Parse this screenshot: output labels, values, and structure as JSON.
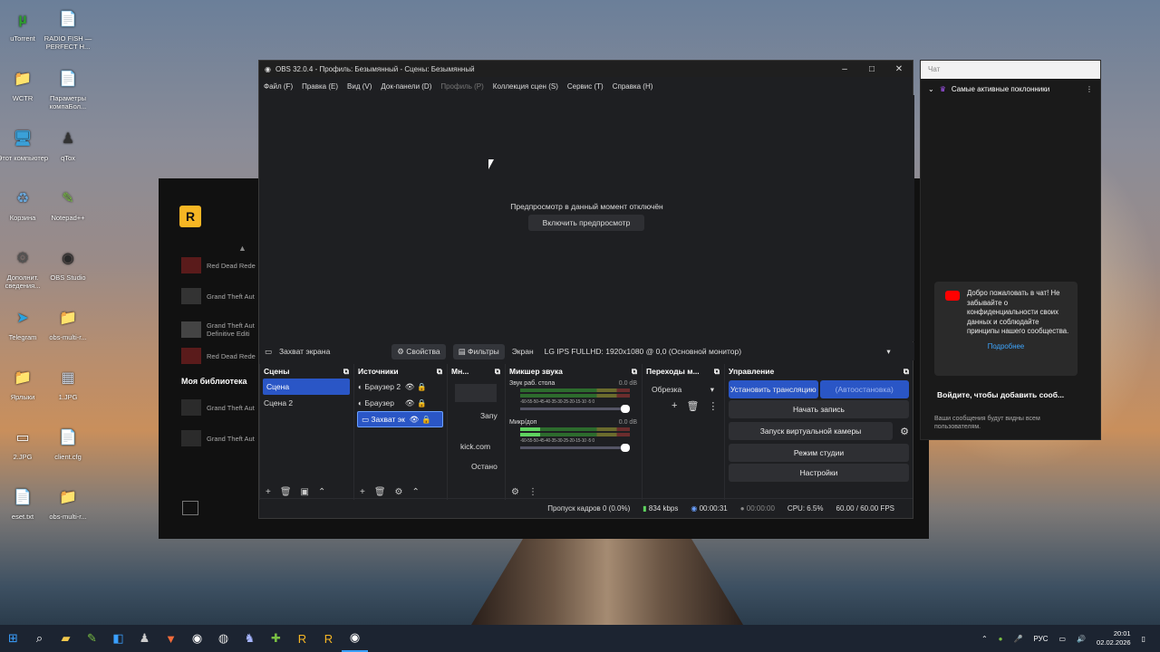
{
  "desktop": {
    "icons": [
      {
        "label": "uTorrent",
        "glyph": "µ",
        "color": "#2ea12e"
      },
      {
        "label": "RADIO FISH — PERFECT H...",
        "glyph": "📄",
        "color": "#eee"
      },
      {
        "label": "WCTR",
        "glyph": "📁",
        "color": "#e8c34a"
      },
      {
        "label": "Параметры компаБол...",
        "glyph": "📄",
        "color": "#eee"
      },
      {
        "label": "Этот компьютер",
        "glyph": "🖥",
        "color": "#3aa0d8"
      },
      {
        "label": "qTox",
        "glyph": "♟",
        "color": "#333"
      },
      {
        "label": "Корзина",
        "glyph": "♻",
        "color": "#6aa6d8"
      },
      {
        "label": "Notepad++",
        "glyph": "✎",
        "color": "#7ac043"
      },
      {
        "label": "Дополнит. сведения...",
        "glyph": "⚙",
        "color": "#555"
      },
      {
        "label": "OBS Studio",
        "glyph": "◉",
        "color": "#2a2a2a"
      },
      {
        "label": "Telegram",
        "glyph": "➤",
        "color": "#2aa3e0"
      },
      {
        "label": "obs-multi-r...",
        "glyph": "📁",
        "color": "#e8c34a"
      },
      {
        "label": "Ярлыки",
        "glyph": "📁",
        "color": "#e8c34a"
      },
      {
        "label": "1.JPG",
        "glyph": "▦",
        "color": "#cfd8e6"
      },
      {
        "label": "2.JPG",
        "glyph": "▭",
        "color": "#fff"
      },
      {
        "label": "client.cfg",
        "glyph": "📄",
        "color": "#eee"
      },
      {
        "label": "eset.txt",
        "glyph": "📄",
        "color": "#eee"
      },
      {
        "label": "obs-multi-r...",
        "glyph": "📁",
        "color": "#e8c34a"
      }
    ]
  },
  "rockstar": {
    "logo": "R",
    "section": "Моя библиотека",
    "games": [
      "Red Dead Rede",
      "Grand Theft Aut",
      "Grand Theft Aut Definitive Editi",
      "Red Dead Rede",
      "Grand Theft Aut",
      "Grand Theft Aut"
    ]
  },
  "obs": {
    "title": "OBS 32.0.4 - Профиль: Безымянный - Сцены: Безымянный",
    "menu": [
      "Файл (F)",
      "Правка (E)",
      "Вид (V)",
      "Док-панели (D)",
      "Профиль (P)",
      "Коллекция сцен (S)",
      "Сервис (T)",
      "Справка (H)"
    ],
    "preview_off": "Предпросмотр в данный момент отключён",
    "preview_btn": "Включить предпросмотр",
    "source_name": "Захват экрана",
    "props_btn": "Свойства",
    "filters_btn": "Фильтры",
    "screen_label": "Экран",
    "monitor": "LG IPS FULLHD: 1920x1080 @ 0,0 (Основной монитор)",
    "scenes": {
      "title": "Сцены",
      "items": [
        "Сцена",
        "Сцена 2"
      ]
    },
    "sources": {
      "title": "Источники",
      "items": [
        "Браузер 2",
        "Браузер",
        "Захват эк"
      ]
    },
    "multi": {
      "title": "Мн...",
      "btn1": "Запу",
      "link": "kick.com",
      "btn2": "Остано"
    },
    "mixer": {
      "title": "Микшер звука",
      "channels": [
        {
          "name": "Звук раб. стола",
          "db": "0.0 dB"
        },
        {
          "name": "Микр/доп",
          "db": "0.0 dB"
        }
      ],
      "scale": "-60-55-50-45-40-35-30-25-20-15-10 -5 0"
    },
    "transitions": {
      "title": "Переходы м...",
      "value": "Обрезка"
    },
    "controls": {
      "title": "Управление",
      "stream": "Установить трансляцию",
      "auto": "(Автоостановка)",
      "record": "Начать запись",
      "vcam": "Запуск виртуальной камеры",
      "studio": "Режим студии",
      "settings": "Настройки"
    },
    "status": {
      "dropped": "Пропуск кадров 0 (0.0%)",
      "kbps": "834 kbps",
      "live": "00:00:31",
      "rec": "00:00:00",
      "cpu": "CPU: 6.5%",
      "fps": "60.00 / 60.00 FPS"
    }
  },
  "chat": {
    "title": "Чат",
    "mode": "Самые активные поклонники",
    "welcome": "Добро пожаловать в чат! Не забывайте о конфиденциальности своих данных и соблюдайте принципы нашего сообщества.",
    "more": "Подробнее",
    "signin": "Войдите, чтобы добавить сооб...",
    "note": "Ваши сообщения будут видны всем пользователям."
  },
  "taskbar": {
    "lang": "РУС",
    "time": "20:01",
    "date": "02.02.2026"
  }
}
